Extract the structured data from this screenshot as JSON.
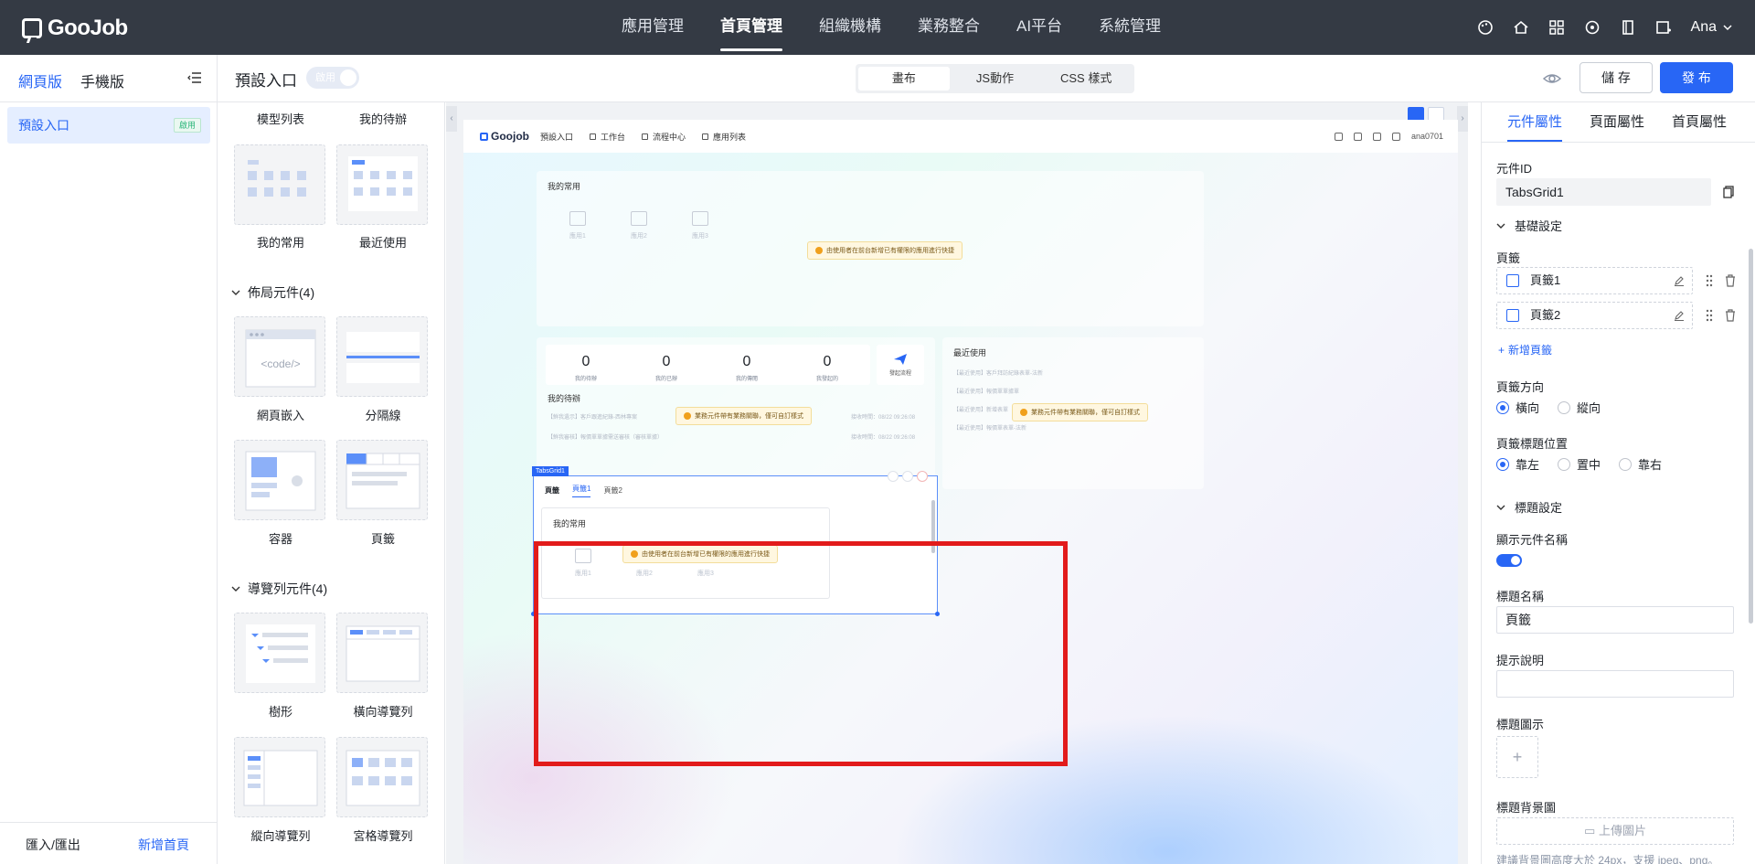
{
  "app": {
    "logo": "GooJob",
    "user": "Ana"
  },
  "topnav": [
    "應用管理",
    "首頁管理",
    "組織機構",
    "業務整合",
    "AI平台",
    "系統管理"
  ],
  "topnav_active": 1,
  "left": {
    "tab_web": "網頁版",
    "tab_mobile": "手機版",
    "item": "預設入口",
    "item_badge": "啟用",
    "import_export": "匯入/匯出",
    "add_home": "新增首頁"
  },
  "subbar": {
    "title": "預設入口",
    "toggle": "啟用",
    "seg": [
      "畫布",
      "JS動作",
      "CSS 樣式"
    ],
    "save": "儲 存",
    "publish": "發 布"
  },
  "palette": {
    "top_labels": [
      "模型列表",
      "我的待辦"
    ],
    "row1": [
      "我的常用",
      "最近使用"
    ],
    "layout_title": "佈局元件(4)",
    "row2": [
      "網頁嵌入",
      "分隔線"
    ],
    "code_text": "<code/>",
    "row3": [
      "容器",
      "頁籤"
    ],
    "nav_title": "導覽列元件(4)",
    "row4": [
      "樹形",
      "橫向導覽列"
    ],
    "row5": [
      "縱向導覽列",
      "宮格導覽列"
    ]
  },
  "preview": {
    "logo": "Goojob",
    "nav": [
      "預設入口",
      "工作台",
      "流程中心",
      "應用列表"
    ],
    "user": "ana0701",
    "common_title": "我的常用",
    "apps": [
      "應用1",
      "應用2",
      "應用3"
    ],
    "warn_common": "由使用者在前台新增已有權限的應用進行快捷",
    "stats": [
      {
        "n": "0",
        "l": "我的待辦"
      },
      {
        "n": "0",
        "l": "我的已辦"
      },
      {
        "n": "0",
        "l": "我的傳閱"
      },
      {
        "n": "0",
        "l": "我發起的"
      }
    ],
    "start_flow": "發起流程",
    "todo_title": "我的待辦",
    "warn_business": "業務元件帶有業務關聯，僅可自訂樣式",
    "todo_lines": [
      "【鮮我遺示】客戶跟進紀錄-西林專案",
      "【鮮我審核】報價單單據需送審核（審核單據）"
    ],
    "todo_times": [
      "接收時間：08/22 09:26:08",
      "接收時間：08/22 09:26:08"
    ],
    "recent_title": "最近使用",
    "recent_lines": [
      "【最近使用】客戶拜訪紀錄表單-法新",
      "【最近使用】報價單單據單",
      "【最近使用】新增表單",
      "【最近使用】報價單表單-法新"
    ],
    "tabsgrid_label": "TabsGrid1",
    "tab_header": "頁籤",
    "tabs": [
      "頁籤1",
      "頁籤2"
    ]
  },
  "props": {
    "tabs": [
      "元件屬性",
      "頁面屬性",
      "首頁屬性"
    ],
    "id_label": "元件ID",
    "id_value": "TabsGrid1",
    "basic": "基礎設定",
    "pages_label": "頁籤",
    "pages": [
      "頁籤1",
      "頁籤2"
    ],
    "add_page": "新增頁籤",
    "direction_label": "頁籤方向",
    "direction": [
      "橫向",
      "縱向"
    ],
    "position_label": "頁籤標題位置",
    "position": [
      "靠左",
      "置中",
      "靠右"
    ],
    "title_settings": "標題設定",
    "show_name": "顯示元件名稱",
    "title_name_label": "標題名稱",
    "title_name_value": "頁籤",
    "hint_label": "提示說明",
    "title_icon": "標題圖示",
    "bg_label": "標題背景圖",
    "upload": "上傳圖片",
    "bg_hint": "建議背景圖高度大於 24px，支援 jpeg、png。"
  }
}
